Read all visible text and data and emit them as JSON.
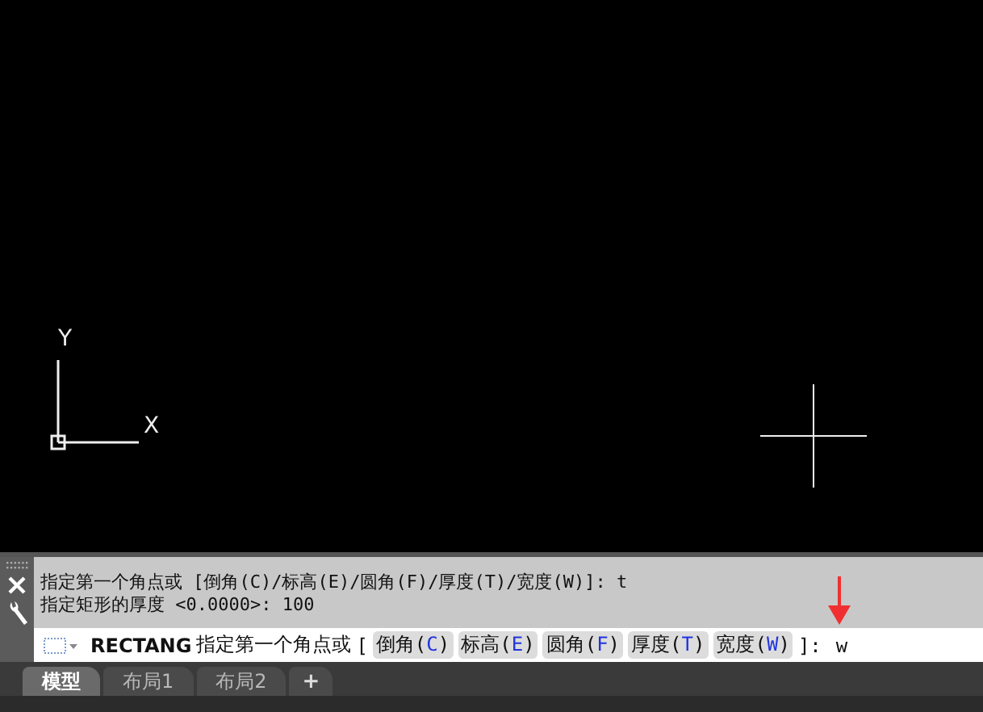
{
  "canvas": {
    "ucs": {
      "x_label": "X",
      "y_label": "Y"
    }
  },
  "command_history": [
    "指定第一个角点或 [倒角(C)/标高(E)/圆角(F)/厚度(T)/宽度(W)]: t",
    "指定矩形的厚度 <0.0000>: 100"
  ],
  "command_line": {
    "command": "RECTANG",
    "prompt": "指定第一个角点或",
    "open_bracket": "[",
    "options": [
      {
        "name": "倒角",
        "paren_open": "(",
        "key": "C",
        "paren_close": ")"
      },
      {
        "name": "标高",
        "paren_open": "(",
        "key": "E",
        "paren_close": ")"
      },
      {
        "name": "圆角",
        "paren_open": "(",
        "key": "F",
        "paren_close": ")"
      },
      {
        "name": "厚度",
        "paren_open": "(",
        "key": "T",
        "paren_close": ")"
      },
      {
        "name": "宽度",
        "paren_open": "(",
        "key": "W",
        "paren_close": ")"
      }
    ],
    "close": "]:",
    "value": "w"
  },
  "tabs": [
    {
      "label": "模型",
      "selected": true
    },
    {
      "label": "布局1",
      "selected": false
    },
    {
      "label": "布局2",
      "selected": false
    }
  ],
  "add_tab": "+"
}
